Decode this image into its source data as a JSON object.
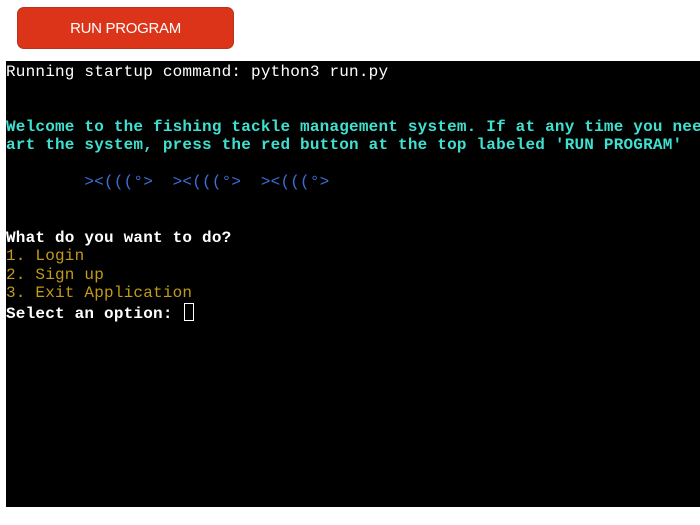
{
  "button": {
    "label": "RUN PROGRAM",
    "color": "#dc3419"
  },
  "terminal": {
    "startup": "Running startup command: python3 run.py",
    "welcome_1": "Welcome to the fishing tackle management system. If at any time you need to rest",
    "welcome_2": "art the system, press the red button at the top labeled 'RUN PROGRAM'",
    "fish": "        ><(((°>  ><(((°>  ><(((°>",
    "prompt": "What do you want to do?",
    "options": [
      "1. Login",
      "2. Sign up",
      "3. Exit Application"
    ],
    "input_label": "Select an option: "
  }
}
